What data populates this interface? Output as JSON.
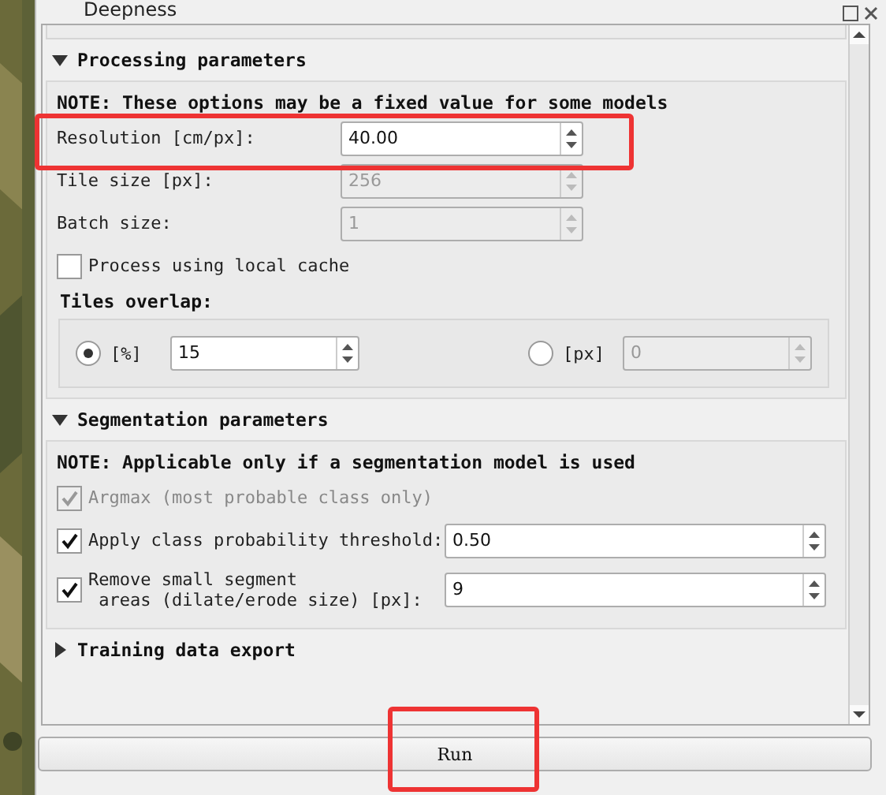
{
  "window": {
    "title": "Deepness"
  },
  "sections": [
    {
      "title": "Processing parameters",
      "expanded": true,
      "note": "NOTE: These options may be a fixed value for some models",
      "fields": [
        {
          "kind": "spin",
          "label": "Resolution [cm/px]:",
          "value": "40.00",
          "disabled": false
        },
        {
          "kind": "spin",
          "label": "Tile size [px]:",
          "value": "256",
          "disabled": true
        },
        {
          "kind": "spin",
          "label": "Batch size:",
          "value": "1",
          "disabled": true
        },
        {
          "kind": "check",
          "label": "Process using local cache",
          "checked": false,
          "disabled": false
        }
      ],
      "overlap": {
        "title": "Tiles overlap:",
        "options": [
          {
            "label": "[%]",
            "selected": true,
            "value": "15"
          },
          {
            "label": "[px]",
            "selected": false,
            "value": "0"
          }
        ]
      }
    },
    {
      "title": "Segmentation parameters",
      "expanded": true,
      "note": "**NOTE**: Applicable only if a segmentation model is used",
      "fields": [
        {
          "kind": "check",
          "label": "Argmax (most probable class only)",
          "checked": true,
          "disabled": true
        },
        {
          "kind": "checkspin",
          "label": "Apply class probability threshold:",
          "checked": true,
          "value": "0.50",
          "disabled": false
        },
        {
          "kind": "checkspin",
          "label": "Remove small segment\n areas (dilate/erode size) [px]:",
          "checked": true,
          "value": "9",
          "disabled": false
        }
      ]
    },
    {
      "title": "Training data export",
      "expanded": false
    }
  ],
  "run_button": "Run"
}
